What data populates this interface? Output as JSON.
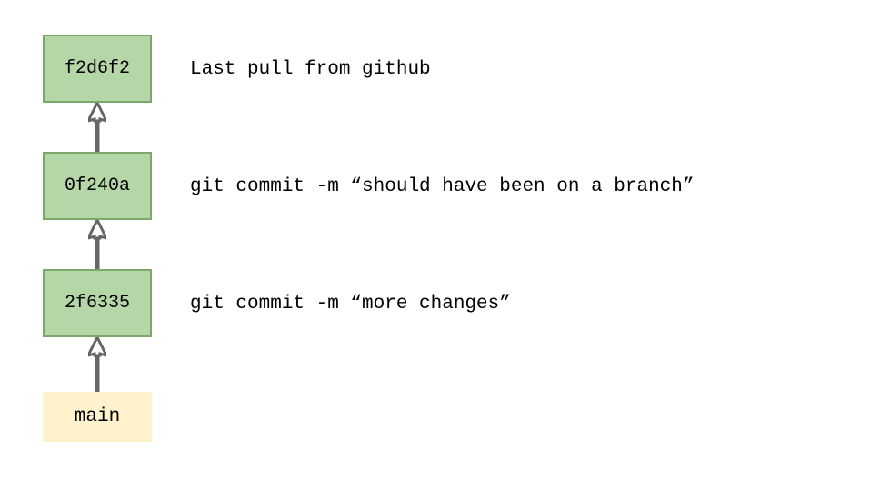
{
  "commits": [
    {
      "hash": "f2d6f2",
      "description": "Last pull from github"
    },
    {
      "hash": "0f240a",
      "description": "git commit -m “should have been on a branch”"
    },
    {
      "hash": "2f6335",
      "description": "git commit -m “more changes”"
    }
  ],
  "branch": {
    "name": "main"
  }
}
